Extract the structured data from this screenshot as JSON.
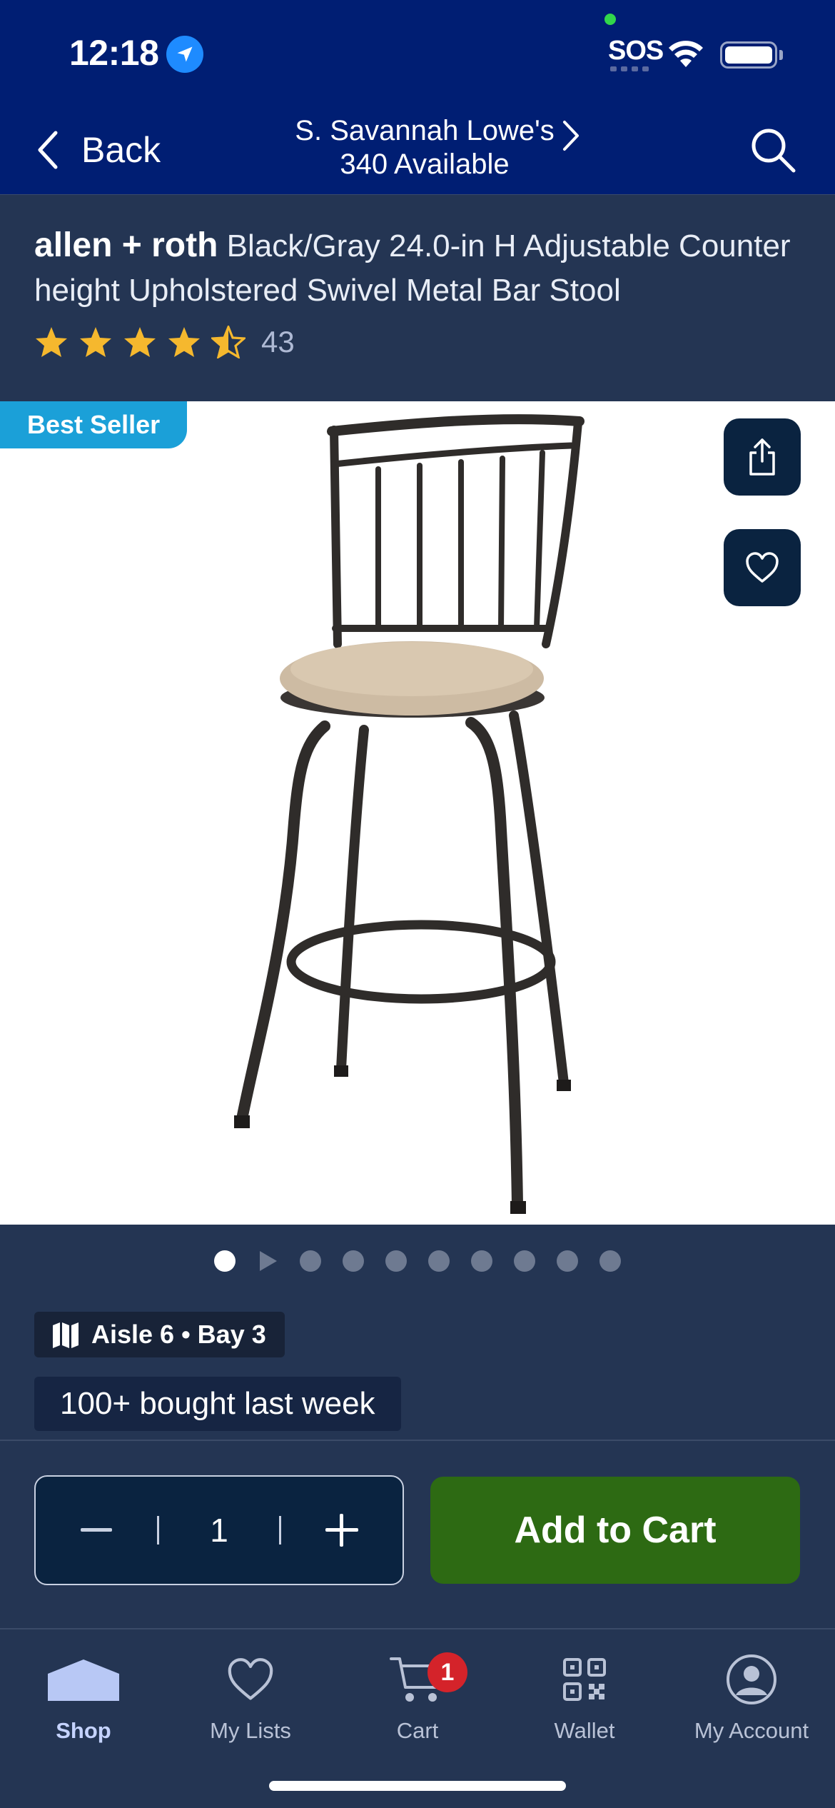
{
  "status_bar": {
    "time": "12:18",
    "sos": "SOS"
  },
  "nav": {
    "back_label": "Back",
    "store_name": "S. Savannah Lowe's",
    "availability": "340 Available"
  },
  "product": {
    "brand": "allen + roth",
    "title": "Black/Gray 24.0-in H Adjustable Counter height Upholstered Swivel Metal Bar Stool",
    "rating_stars": 4.5,
    "review_count": "43",
    "badge": "Best Seller",
    "image_index": 1,
    "image_count": 10
  },
  "location": {
    "aisle": "Aisle 6 • Bay 3"
  },
  "social_proof": "100+ bought last week",
  "purchase": {
    "quantity": "1",
    "add_to_cart_label": "Add to Cart"
  },
  "tabs": [
    {
      "label": "Shop",
      "icon": "home-icon",
      "active": true
    },
    {
      "label": "My Lists",
      "icon": "heart-icon",
      "active": false
    },
    {
      "label": "Cart",
      "icon": "cart-icon",
      "active": false,
      "badge": "1"
    },
    {
      "label": "Wallet",
      "icon": "qr-code-icon",
      "active": false
    },
    {
      "label": "My Account",
      "icon": "account-icon",
      "active": false
    }
  ],
  "colors": {
    "header": "#001e73",
    "page": "#243553",
    "accent_green": "#2d6a13",
    "badge_blue": "#1ba0d8",
    "star": "#f5b82e"
  }
}
